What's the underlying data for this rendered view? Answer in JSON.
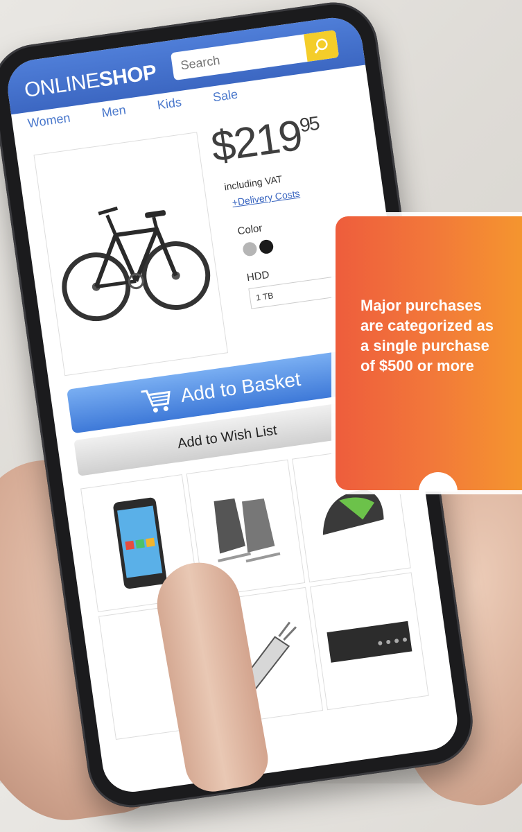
{
  "shop": {
    "logo_light": "ONLINE",
    "logo_bold": "SHOP",
    "search_placeholder": "Search",
    "nav": [
      "Women",
      "Men",
      "Kids",
      "Sale"
    ]
  },
  "product": {
    "price_main": "$219",
    "price_cents": "95",
    "vat_text": "including VAT",
    "delivery_link": "+Delivery Costs",
    "color_label": "Color",
    "hdd_label": "HDD",
    "hdd_value": "1 TB",
    "add_to_basket": "Add to Basket",
    "add_to_wishlist": "Add to Wish List",
    "colors": [
      "#b5b5b5",
      "#1a1a1a"
    ]
  },
  "callout": {
    "text": "Major purchases\nare categorized as\na single purchase\nof $500 or more"
  },
  "colors": {
    "brand_blue": "#3c67c2",
    "search_yellow": "#f4cd2a",
    "callout_start": "#ee5d3c",
    "callout_end": "#f59c2c"
  }
}
